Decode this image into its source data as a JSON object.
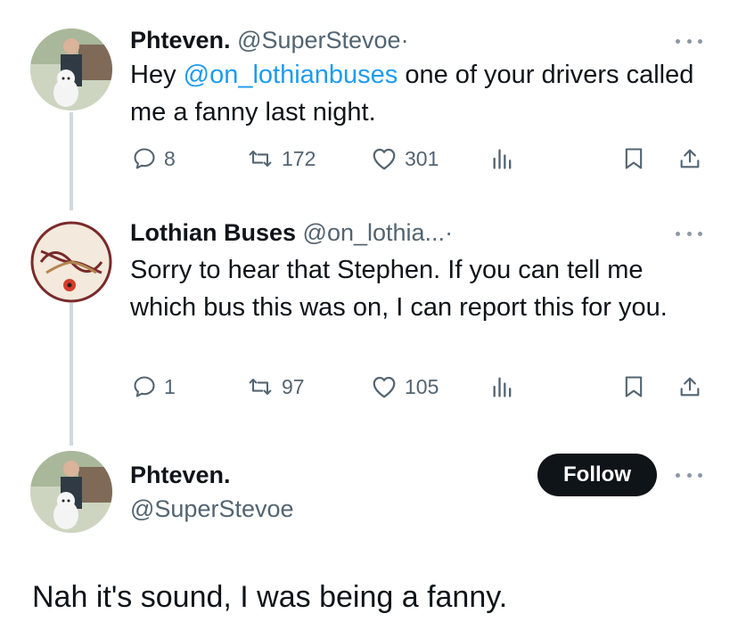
{
  "tweet1": {
    "name": "Phteven.",
    "handle": "@SuperStevoe",
    "dot": "·",
    "text_before": "Hey ",
    "mention": "@on_lothianbuses",
    "text_after": " one of your drivers called me a fanny last night.",
    "replies": "8",
    "retweets": "172",
    "likes": "301"
  },
  "tweet2": {
    "name": "Lothian Buses",
    "handle": "@on_lothia...",
    "dot": "·",
    "text": "Sorry to hear that Stephen. If you can tell me which bus this was on, I can report this for you.",
    "replies": "1",
    "retweets": "97",
    "likes": "105"
  },
  "tweet3": {
    "name": "Phteven.",
    "handle": "@SuperStevoe",
    "follow_label": "Follow",
    "text": "Nah it's sound, I was being a fanny."
  },
  "colors": {
    "accent": "#1d9bf0",
    "text": "#0f1419",
    "muted": "#536471",
    "thread_line": "#cfd9de",
    "lothian_maroon": "#7a2a2a"
  },
  "icons": [
    "reply-icon",
    "retweet-icon",
    "like-icon",
    "views-icon",
    "bookmark-icon",
    "share-icon",
    "more-icon"
  ]
}
